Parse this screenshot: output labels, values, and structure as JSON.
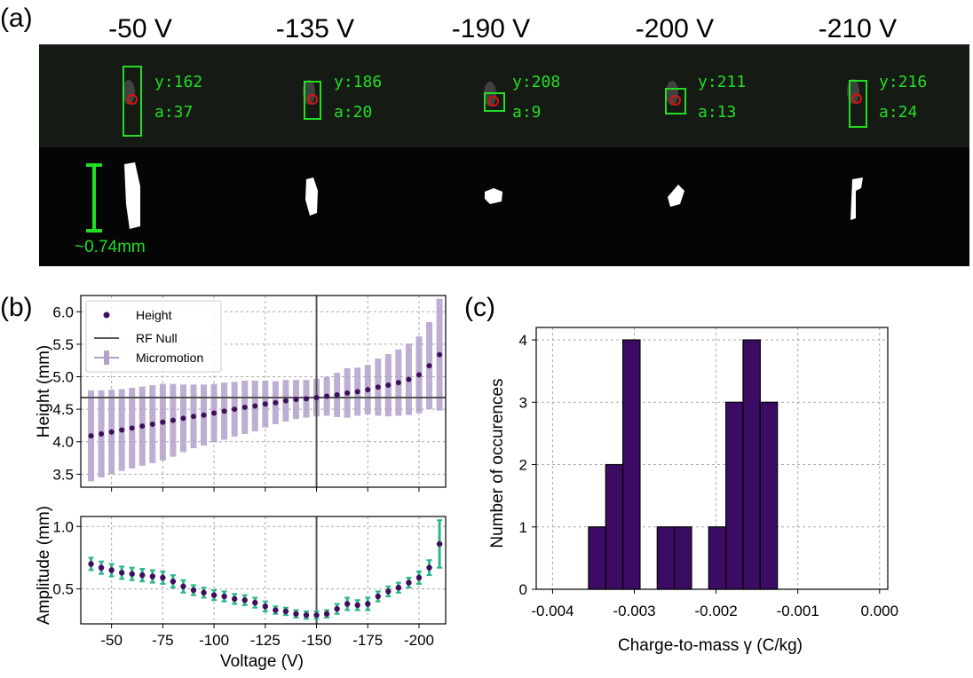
{
  "panel_labels": {
    "a": "(a)",
    "b": "(b)",
    "c": "(c)"
  },
  "panel_a": {
    "frames": [
      {
        "voltage": "-50 V",
        "y_label": "y:162",
        "a_label": "a:37"
      },
      {
        "voltage": "-135 V",
        "y_label": "y:186",
        "a_label": "a:20"
      },
      {
        "voltage": "-190 V",
        "y_label": "y:208",
        "a_label": "a:9"
      },
      {
        "voltage": "-200 V",
        "y_label": "y:211",
        "a_label": "a:13"
      },
      {
        "voltage": "-210 V",
        "y_label": "y:216",
        "a_label": "a:24"
      }
    ],
    "scale_label": "~0.74mm",
    "colors": {
      "overlay": "#22dd22",
      "marker": "#dd1111",
      "background": "#0a0a0a"
    }
  },
  "chart_data": [
    {
      "id": "height",
      "type": "scatter",
      "xlabel": "",
      "ylabel": "Height (mm)",
      "xlim": [
        -35,
        -213
      ],
      "ylim": [
        3.3,
        6.25
      ],
      "x_reversed": true,
      "yticks": [
        3.5,
        4.0,
        4.5,
        5.0,
        5.5,
        6.0
      ],
      "ytick_labels": [
        "3.5",
        "4.0",
        "4.5",
        "5.0",
        "5.5",
        "6.0"
      ],
      "xticks": [
        -50,
        -75,
        -100,
        -125,
        -150,
        -175,
        -200
      ],
      "grid": true,
      "rf_null": {
        "x": -150,
        "y": 4.68
      },
      "legend": {
        "position": "top-left",
        "entries": [
          "Height",
          "RF Null",
          "Micromotion"
        ]
      },
      "series": [
        {
          "name": "Height",
          "x": [
            -40,
            -45,
            -50,
            -55,
            -60,
            -65,
            -70,
            -75,
            -80,
            -85,
            -90,
            -95,
            -100,
            -105,
            -110,
            -115,
            -120,
            -125,
            -130,
            -135,
            -140,
            -145,
            -150,
            -155,
            -160,
            -165,
            -170,
            -175,
            -180,
            -185,
            -190,
            -195,
            -200,
            -205,
            -210
          ],
          "y": [
            4.09,
            4.12,
            4.15,
            4.18,
            4.21,
            4.24,
            4.27,
            4.3,
            4.33,
            4.36,
            4.39,
            4.41,
            4.44,
            4.47,
            4.5,
            4.53,
            4.55,
            4.58,
            4.6,
            4.63,
            4.65,
            4.66,
            4.68,
            4.7,
            4.72,
            4.75,
            4.77,
            4.8,
            4.84,
            4.87,
            4.91,
            4.96,
            5.03,
            5.17,
            5.34
          ]
        },
        {
          "name": "Micromotion",
          "amplitude": [
            0.7,
            0.67,
            0.65,
            0.63,
            0.62,
            0.61,
            0.6,
            0.59,
            0.56,
            0.52,
            0.49,
            0.47,
            0.45,
            0.44,
            0.42,
            0.41,
            0.39,
            0.36,
            0.33,
            0.32,
            0.3,
            0.29,
            0.29,
            0.3,
            0.34,
            0.38,
            0.37,
            0.38,
            0.44,
            0.48,
            0.51,
            0.55,
            0.59,
            0.67,
            0.86
          ]
        }
      ],
      "colors": {
        "points": "#3d0f5c",
        "bars": "#b3a0ca",
        "rf_null": "#555555"
      }
    },
    {
      "id": "amplitude",
      "type": "scatter",
      "xlabel": "Voltage (V)",
      "ylabel": "Amplitude (mm)",
      "xlim": [
        -35,
        -213
      ],
      "ylim": [
        0.22,
        1.08
      ],
      "x_reversed": true,
      "yticks": [
        0.5,
        1.0
      ],
      "ytick_labels": [
        "0.5",
        "1.0"
      ],
      "xticks": [
        -50,
        -75,
        -100,
        -125,
        -150,
        -175,
        -200
      ],
      "xtick_labels": [
        "-50",
        "-75",
        "-100",
        "-125",
        "-150",
        "-175",
        "-200"
      ],
      "grid": true,
      "rf_null_x": -150,
      "series": [
        {
          "name": "",
          "x": [
            -40,
            -45,
            -50,
            -55,
            -60,
            -65,
            -70,
            -75,
            -80,
            -85,
            -90,
            -95,
            -100,
            -105,
            -110,
            -115,
            -120,
            -125,
            -130,
            -135,
            -140,
            -145,
            -150,
            -155,
            -160,
            -165,
            -170,
            -175,
            -180,
            -185,
            -190,
            -195,
            -200,
            -205,
            -210
          ],
          "y": [
            0.7,
            0.67,
            0.65,
            0.63,
            0.62,
            0.61,
            0.6,
            0.59,
            0.56,
            0.52,
            0.49,
            0.47,
            0.45,
            0.44,
            0.42,
            0.41,
            0.39,
            0.36,
            0.33,
            0.32,
            0.3,
            0.29,
            0.29,
            0.3,
            0.34,
            0.38,
            0.37,
            0.38,
            0.44,
            0.48,
            0.51,
            0.55,
            0.59,
            0.67,
            0.86
          ],
          "err": [
            0.05,
            0.05,
            0.05,
            0.05,
            0.05,
            0.05,
            0.05,
            0.05,
            0.05,
            0.05,
            0.04,
            0.04,
            0.04,
            0.04,
            0.04,
            0.04,
            0.04,
            0.04,
            0.03,
            0.03,
            0.03,
            0.03,
            0.03,
            0.03,
            0.04,
            0.05,
            0.04,
            0.05,
            0.04,
            0.04,
            0.04,
            0.04,
            0.05,
            0.06,
            0.19
          ]
        }
      ],
      "colors": {
        "points": "#3d0f5c",
        "errorbars": "#2bb58a",
        "rf_null": "#555555"
      }
    },
    {
      "id": "histogram",
      "type": "bar",
      "xlabel": "Charge-to-mass γ (C/kg)",
      "ylabel": "Number of occurences",
      "xlim": [
        -0.0042,
        0.0001
      ],
      "ylim": [
        0,
        4.2
      ],
      "xticks": [
        -0.004,
        -0.003,
        -0.002,
        -0.001,
        0.0
      ],
      "xtick_labels": [
        "-0.004",
        "-0.003",
        "-0.002",
        "-0.001",
        "0.000"
      ],
      "yticks": [
        0,
        1,
        2,
        3,
        4
      ],
      "ytick_labels": [
        "0",
        "1",
        "2",
        "3",
        "4"
      ],
      "grid": true,
      "bin_edges": [
        -0.00356,
        -0.00335,
        -0.00314,
        -0.00293,
        -0.00272,
        -0.00251,
        -0.0023,
        -0.00209,
        -0.00188,
        -0.00167,
        -0.00146,
        -0.00125
      ],
      "values": [
        1,
        2,
        4,
        0,
        1,
        1,
        0,
        1,
        3,
        4,
        3
      ],
      "colors": {
        "bars": "#3c0b64",
        "edges": "#000000"
      }
    }
  ]
}
